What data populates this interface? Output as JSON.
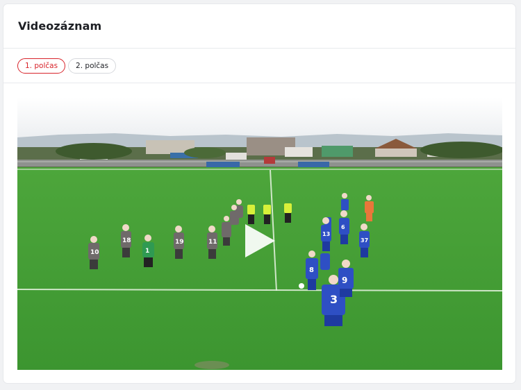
{
  "card": {
    "title": "Videozáznam"
  },
  "tabs": [
    {
      "label": "1. polčas",
      "active": true
    },
    {
      "label": "2. polčas",
      "active": false
    }
  ],
  "video": {
    "state": "paused",
    "icon": "play-icon"
  },
  "colors": {
    "accent": "#d8232a",
    "text": "#1d1f24",
    "pitch": "#3f9a34"
  }
}
